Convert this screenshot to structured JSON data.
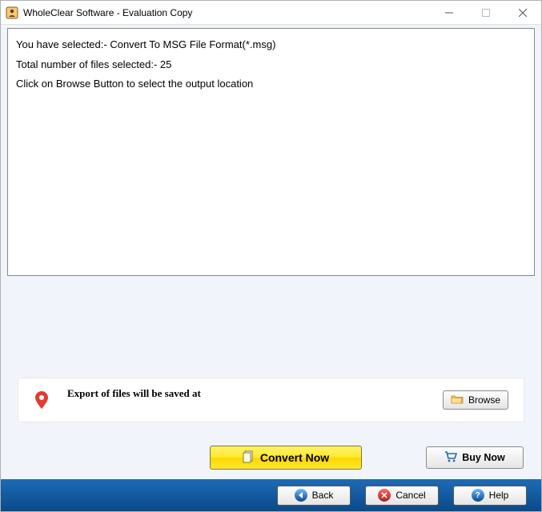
{
  "window": {
    "title": "WholeClear Software - Evaluation Copy"
  },
  "info": {
    "line1": "You have selected:- Convert To MSG File Format(*.msg)",
    "line2": "Total number of files selected:- 25",
    "line3": "Click on Browse Button to select the output location"
  },
  "export": {
    "label": "Export of files will be saved at",
    "browse": "Browse"
  },
  "actions": {
    "convert": "Convert Now",
    "buy": "Buy Now"
  },
  "footer": {
    "back": "Back",
    "cancel": "Cancel",
    "help": "Help"
  }
}
